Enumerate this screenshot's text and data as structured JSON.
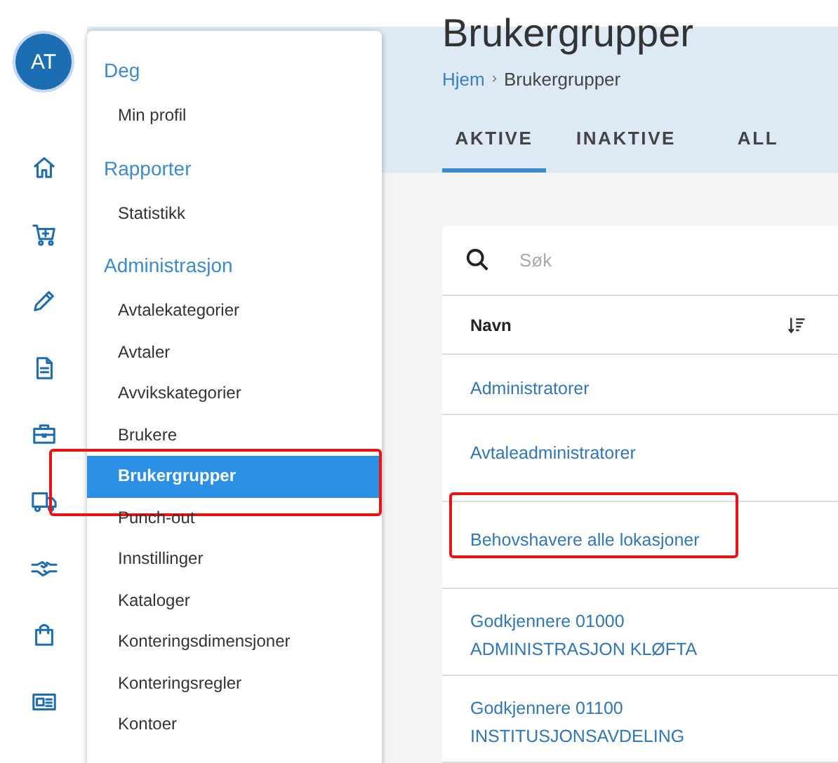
{
  "user": {
    "initials": "AT"
  },
  "menu": {
    "sections": [
      {
        "title": "Deg",
        "items": [
          {
            "label": "Min profil",
            "selected": false,
            "circled": false
          }
        ]
      },
      {
        "title": "Rapporter",
        "items": [
          {
            "label": "Statistikk",
            "selected": false,
            "circled": false
          }
        ]
      },
      {
        "title": "Administrasjon",
        "items": [
          {
            "label": "Avtalekategorier",
            "selected": false,
            "circled": false
          },
          {
            "label": "Avtaler",
            "selected": false,
            "circled": false
          },
          {
            "label": "Avvikskategorier",
            "selected": false,
            "circled": false
          },
          {
            "label": "Brukere",
            "selected": false,
            "circled": false
          },
          {
            "label": "Brukergrupper",
            "selected": true,
            "circled": true
          },
          {
            "label": "Punch-out",
            "selected": false,
            "circled": false
          },
          {
            "label": "Innstillinger",
            "selected": false,
            "circled": false
          },
          {
            "label": "Kataloger",
            "selected": false,
            "circled": false
          },
          {
            "label": "Konteringsdimensjoner",
            "selected": false,
            "circled": false
          },
          {
            "label": "Konteringsregler",
            "selected": false,
            "circled": false
          },
          {
            "label": "Kontoer",
            "selected": false,
            "circled": false
          }
        ]
      }
    ]
  },
  "page": {
    "title": "Brukergrupper",
    "breadcrumb": [
      "Hjem",
      "Brukergrupper"
    ],
    "breadcrumb_separator": "›"
  },
  "tabs": [
    {
      "label": "AKTIVE",
      "selected": true
    },
    {
      "label": "INAKTIVE",
      "selected": false
    },
    {
      "label": "ALL",
      "selected": false
    }
  ],
  "search": {
    "placeholder": "Søk"
  },
  "table": {
    "columns": [
      "Navn"
    ],
    "rows": [
      {
        "lines": [
          "Administratorer"
        ],
        "circled": false
      },
      {
        "lines": [
          "Avtaleadministratorer"
        ],
        "circled": false
      },
      {
        "lines": [
          "Behovshavere alle lokasjoner"
        ],
        "circled": true
      },
      {
        "lines": [
          "Godkjennere 01000",
          "ADMINISTRASJON KLØFTA"
        ],
        "circled": false
      },
      {
        "lines": [
          "Godkjennere 01100",
          "INSTITUSJONSAVDELING"
        ],
        "circled": false
      }
    ]
  }
}
